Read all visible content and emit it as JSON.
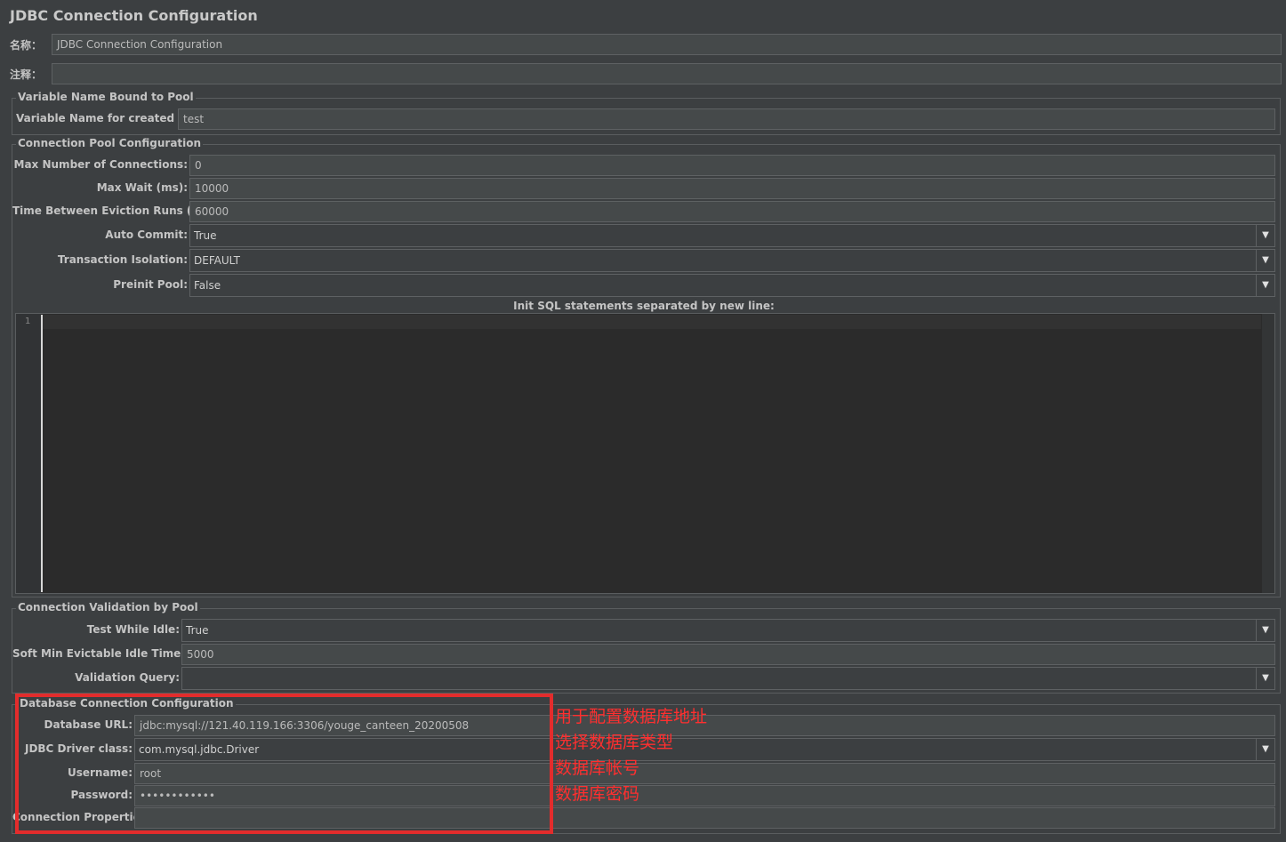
{
  "header": {
    "title": "JDBC Connection Configuration"
  },
  "name_field": {
    "label": "名称：",
    "value": "JDBC Connection Configuration"
  },
  "comment_field": {
    "label": "注释：",
    "value": ""
  },
  "variable_group": {
    "legend": "Variable Name Bound to Pool",
    "pool_name_label": "Variable Name for created pool:",
    "pool_name_value": "test"
  },
  "pool_group": {
    "legend": "Connection Pool Configuration",
    "max_connections_label": "Max Number of Connections:",
    "max_connections_value": "0",
    "max_wait_label": "Max Wait (ms):",
    "max_wait_value": "10000",
    "eviction_label": "Time Between Eviction Runs (ms):",
    "eviction_value": "60000",
    "auto_commit_label": "Auto Commit:",
    "auto_commit_value": "True",
    "isolation_label": "Transaction Isolation:",
    "isolation_value": "DEFAULT",
    "preinit_label": "Preinit Pool:",
    "preinit_value": "False",
    "init_sql_label": "Init SQL statements separated by new line:",
    "init_sql_line_number": "1"
  },
  "validation_group": {
    "legend": "Connection Validation by Pool",
    "test_idle_label": "Test While Idle:",
    "test_idle_value": "True",
    "soft_min_label": "Soft Min Evictable Idle Time(ms):",
    "soft_min_value": "5000",
    "query_label": "Validation Query:",
    "query_value": ""
  },
  "db_group": {
    "legend": "Database Connection Configuration",
    "url_label": "Database URL:",
    "url_value": "jdbc:mysql://121.40.119.166:3306/youge_canteen_20200508",
    "driver_label": "JDBC Driver class:",
    "driver_value": "com.mysql.jdbc.Driver",
    "username_label": "Username:",
    "username_value": "root",
    "password_label": "Password:",
    "password_value": "••••••••••••",
    "properties_label": "Connection Properties:",
    "properties_value": ""
  },
  "annotations": [
    "用于配置数据库地址",
    "选择数据库类型",
    "数据库帐号",
    "数据库密码"
  ],
  "colors": {
    "background": "#3c3f41",
    "field": "#45494a",
    "editor": "#2b2b2b",
    "annotation_red": "#e32c2c"
  },
  "icons": {
    "dropdown": "chevron-down-icon"
  }
}
